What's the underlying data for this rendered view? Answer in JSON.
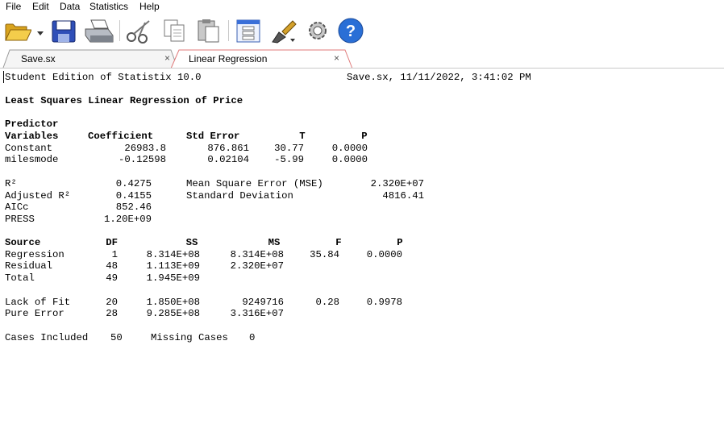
{
  "menu": [
    "File",
    "Edit",
    "Data",
    "Statistics",
    "Help"
  ],
  "toolbar": {
    "icons": [
      "open-folder-icon",
      "dropdown-arrow-icon",
      "save-disk-icon",
      "printer-icon",
      "cut-scissors-icon",
      "copy-icon",
      "paste-icon",
      "dialog-window-icon",
      "brush-icon",
      "settings-gear-icon",
      "help-icon"
    ],
    "help_glyph": "?"
  },
  "tabs": [
    {
      "label": "Save.sx",
      "close": "×",
      "active": false
    },
    {
      "label": "Linear Regression",
      "close": "×",
      "active": true
    }
  ],
  "report": {
    "edition": "Student Edition of Statistix 10.0",
    "file_stamp": "Save.sx, 11/11/2022, 3:41:02 PM",
    "title": "Least Squares Linear Regression of Price",
    "coef_header1": "Predictor",
    "coef_cols": [
      "Variables",
      "Coefficient",
      "Std Error",
      "T",
      "P"
    ],
    "coef_rows": [
      [
        "Constant",
        "26983.8",
        "876.861",
        "30.77",
        "0.0000"
      ],
      [
        "milesmode",
        "-0.12598",
        "0.02104",
        "-5.99",
        "0.0000"
      ]
    ],
    "fit_stats": [
      [
        "R²",
        "0.4275"
      ],
      [
        "Adjusted R²",
        "0.4155"
      ],
      [
        "AICc",
        "852.46"
      ],
      [
        "PRESS",
        "1.20E+09"
      ]
    ],
    "mse_label": "Mean Square Error (MSE)",
    "mse_value": "2.320E+07",
    "sd_label": "Standard Deviation",
    "sd_value": "4816.41",
    "anova_cols": [
      "Source",
      "DF",
      "SS",
      "MS",
      "F",
      "P"
    ],
    "anova_rows": [
      [
        "Regression",
        "1",
        "8.314E+08",
        "8.314E+08",
        "35.84",
        "0.0000"
      ],
      [
        "Residual",
        "48",
        "1.113E+09",
        "2.320E+07",
        "",
        ""
      ],
      [
        "Total",
        "49",
        "1.945E+09",
        "",
        "",
        ""
      ]
    ],
    "lof_rows": [
      [
        "Lack of Fit",
        "20",
        "1.850E+08",
        "9249716",
        "0.28",
        "0.9978"
      ],
      [
        "Pure Error",
        "28",
        "9.285E+08",
        "3.316E+07",
        "",
        ""
      ]
    ],
    "cases_label": "Cases Included",
    "cases_value": "50",
    "missing_label": "Missing Cases",
    "missing_value": "0"
  }
}
